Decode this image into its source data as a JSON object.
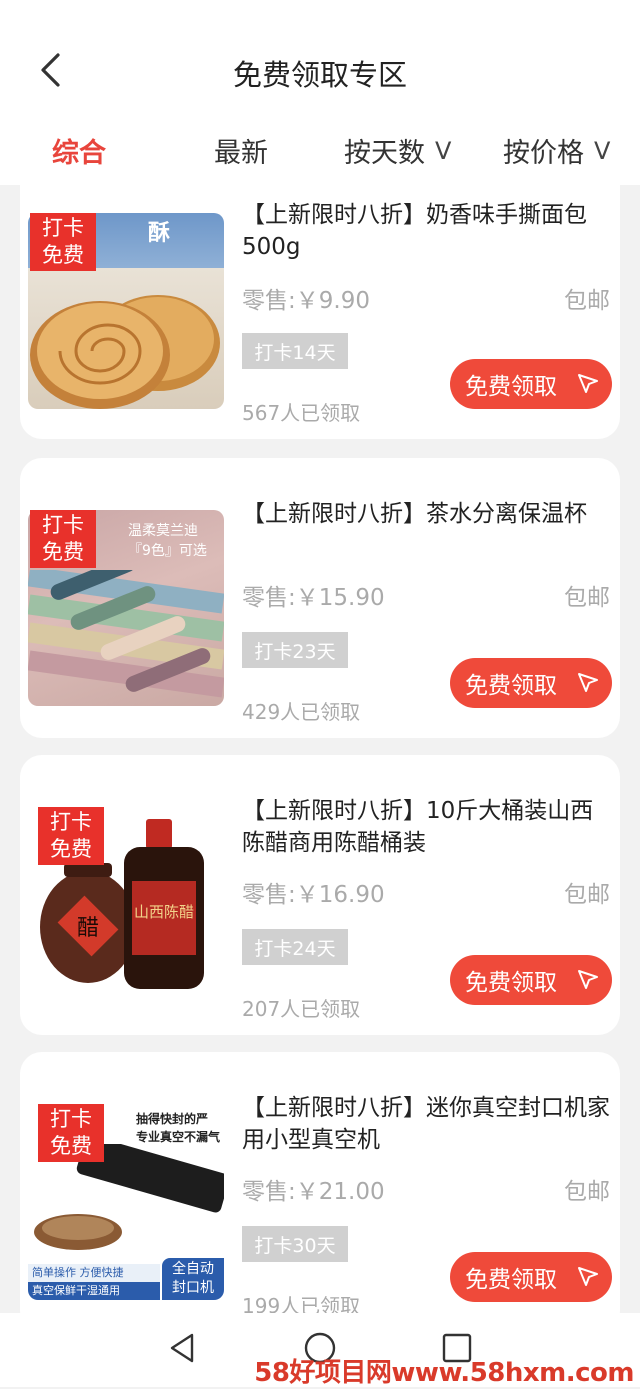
{
  "header": {
    "title": "免费领取专区"
  },
  "tabs": [
    {
      "label": "综合"
    },
    {
      "label": "最新"
    },
    {
      "label": "按天数"
    },
    {
      "label": "按价格"
    }
  ],
  "tab_suffix": "V",
  "badge": {
    "line1": "打卡",
    "line2": "免费"
  },
  "products": [
    {
      "title": "【上新限时八折】奶香味手撕面包500g",
      "price": "零售:￥9.90",
      "shipping": "包邮",
      "days": "打卡14天",
      "claimed": "567人已领取",
      "button": "免费领取",
      "image_text": "酥"
    },
    {
      "title": "【上新限时八折】茶水分离保温杯",
      "price": "零售:￥15.90",
      "shipping": "包邮",
      "days": "打卡23天",
      "claimed": "429人已领取",
      "button": "免费领取",
      "image_text1": "温柔莫兰迪",
      "image_text2": "『9色』可选"
    },
    {
      "title": "【上新限时八折】10斤大桶装山西陈醋商用陈醋桶装",
      "price": "零售:￥16.90",
      "shipping": "包邮",
      "days": "打卡24天",
      "claimed": "207人已领取",
      "button": "免费领取",
      "image_text1": "醋",
      "image_text2": "山西陈醋"
    },
    {
      "title": "【上新限时八折】迷你真空封口机家用小型真空机",
      "price": "零售:￥21.00",
      "shipping": "包邮",
      "days": "打卡30天",
      "claimed": "199人已领取",
      "button": "免费领取",
      "image_text1": "抽得快封的严",
      "image_text2": "专业真空不漏气",
      "image_text3": "简单操作 方便快捷",
      "image_text4": "真空保鲜干湿通用",
      "image_text5": "全自动",
      "image_text6": "封口机"
    }
  ],
  "watermark": "58好项目网www.58hxm.com",
  "colors": {
    "accent": "#e8453c",
    "button": "#ef4a3a",
    "badge": "#e8312b",
    "tag": "#d0d0d0"
  }
}
